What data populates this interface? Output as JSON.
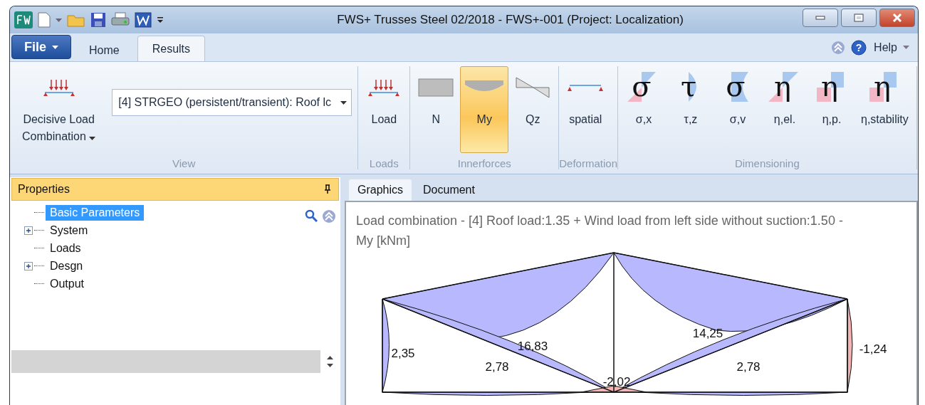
{
  "window": {
    "title": "FWS+ Trusses Steel  02/2018 - FWS+-001 (Project: Localization)"
  },
  "ribbon_tabs": [
    {
      "label": "File",
      "kind": "file",
      "selected": false
    },
    {
      "label": "Home",
      "kind": "tab",
      "selected": false
    },
    {
      "label": "Results",
      "kind": "tab",
      "selected": true
    }
  ],
  "help": {
    "label": "Help",
    "icon_glyph": "?"
  },
  "ribbon_groups": [
    {
      "label": "View",
      "combo": {
        "value": "[4] STRGEO (persistent/transient): Roof lc"
      },
      "items": [
        {
          "kind": "load",
          "label": "Decisive Load",
          "label_2": "Combination",
          "selected": false
        }
      ]
    },
    {
      "label": "Loads",
      "items": [
        {
          "kind": "load",
          "label": "Load",
          "selected": false
        }
      ]
    },
    {
      "label": "Innerforces",
      "items": [
        {
          "kind": "normal",
          "label": "N",
          "selected": false
        },
        {
          "kind": "moment",
          "label": "My",
          "selected": true
        },
        {
          "kind": "shear",
          "label": "Qz",
          "selected": false
        }
      ]
    },
    {
      "label": "Deformation",
      "items": [
        {
          "kind": "deformation",
          "label": "spatial",
          "selected": false
        }
      ]
    },
    {
      "label": "Dimensioning",
      "items": [
        {
          "kind": "sigmax",
          "symbol": "σ",
          "label": "σ,x",
          "selected": false
        },
        {
          "kind": "tau",
          "symbol": "τ",
          "label": "τ,z",
          "selected": false
        },
        {
          "kind": "sigmav",
          "symbol": "σ",
          "label": "σ,v",
          "selected": false
        },
        {
          "kind": "etael",
          "symbol": "η",
          "label": "η,el.",
          "selected": false
        },
        {
          "kind": "etapl",
          "symbol": "η",
          "label": "η,p.",
          "selected": false
        },
        {
          "kind": "etastab",
          "symbol": "η",
          "label": "η,stability",
          "selected": false
        }
      ]
    }
  ],
  "properties": {
    "title": "Properties",
    "tree": [
      {
        "label": "Basic Parameters",
        "selected": true,
        "collapsed": false
      },
      {
        "label": "System",
        "selected": false,
        "collapsed": true
      },
      {
        "label": "Loads",
        "selected": false,
        "collapsed": false
      },
      {
        "label": "Desgn",
        "selected": false,
        "collapsed": true
      },
      {
        "label": "Output",
        "selected": false,
        "collapsed": false
      }
    ]
  },
  "view_tabs": [
    {
      "label": "Graphics",
      "selected": true
    },
    {
      "label": "Document",
      "selected": false
    }
  ],
  "graphics": {
    "caption": "Load combination - [4] Roof load:1.35 + Wind load from left side without suction:1.50 -",
    "unit": "My [kNm]",
    "values": [
      "2,35",
      "16,83",
      "2,78",
      "-2,02",
      "14,25",
      "2,78",
      "-1,24"
    ]
  }
}
